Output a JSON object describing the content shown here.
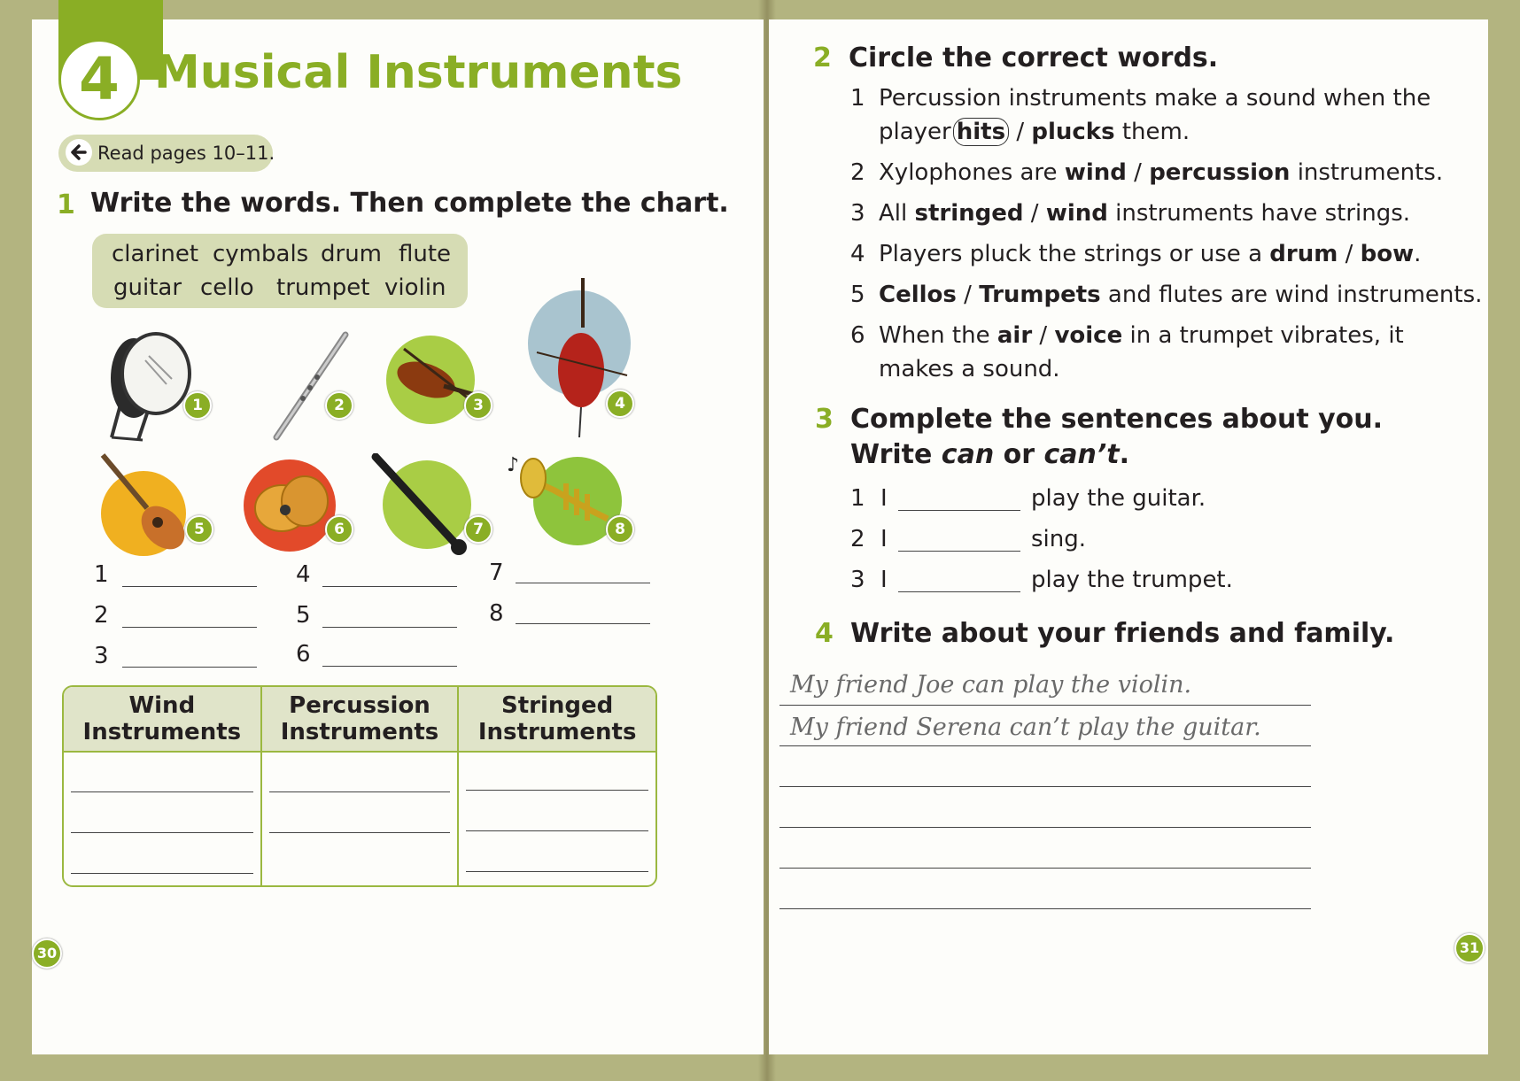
{
  "left_page": {
    "unit_number": "4",
    "title": "Musical Instruments",
    "read_pages": "Read pages 10–11.",
    "q1": {
      "number": "1",
      "instruction": "Write the words. Then complete the chart.",
      "word_bank": [
        "clarinet",
        "cymbals",
        "drum",
        "flute",
        "guitar",
        "cello",
        "trumpet",
        "violin"
      ],
      "picture_numbers": [
        "1",
        "2",
        "3",
        "4",
        "5",
        "6",
        "7",
        "8"
      ],
      "answer_labels": [
        "1",
        "2",
        "3",
        "4",
        "5",
        "6",
        "7",
        "8"
      ],
      "chart_headers": [
        "Wind Instruments",
        "Percussion Instruments",
        "Stringed Instruments"
      ]
    },
    "page_number": "30"
  },
  "right_page": {
    "q2": {
      "number": "2",
      "instruction": "Circle the correct words.",
      "items": [
        {
          "n": "1",
          "l1_pre": "Percussion instruments make a sound when the",
          "l2_pre": "player",
          "circled": "hits",
          "sep": "/",
          "bold": "plucks",
          "post": "them."
        },
        {
          "n": "2",
          "pre": "Xylophones are",
          "opt1": "wind",
          "sep": "/",
          "opt2": "percussion",
          "post": "instruments."
        },
        {
          "n": "3",
          "pre": "All",
          "opt1": "stringed",
          "sep": "/",
          "opt2": "wind",
          "post": "instruments have strings."
        },
        {
          "n": "4",
          "pre": "Players pluck the strings or use a",
          "opt1": "drum",
          "sep": "/",
          "opt2": "bow",
          "post": "."
        },
        {
          "n": "5",
          "pre": "",
          "opt1": "Cellos",
          "sep": "/",
          "opt2": "Trumpets",
          "post": "and flutes are wind instruments."
        },
        {
          "n": "6",
          "pre": "When the",
          "opt1": "air",
          "sep": "/",
          "opt2": "voice",
          "post": "in a trumpet vibrates, it",
          "line2": "makes a sound."
        }
      ]
    },
    "q3": {
      "number": "3",
      "instruction_line1": "Complete the sentences about you.",
      "instruction_line2_pre": "Write",
      "word_can": "can",
      "word_or": "or",
      "word_cant": "can’t",
      "period": ".",
      "items": [
        {
          "n": "1",
          "subject": "I",
          "text": "play the guitar."
        },
        {
          "n": "2",
          "subject": "I",
          "text": "sing."
        },
        {
          "n": "3",
          "subject": "I",
          "text": "play the trumpet."
        }
      ]
    },
    "q4": {
      "number": "4",
      "instruction": "Write about your friends and family.",
      "examples": [
        "My friend Joe can play the violin.",
        "My friend Serena can’t play the guitar."
      ]
    },
    "page_number": "31"
  },
  "colors": {
    "accent_green": "#8aae25",
    "word_bank_bg": "#d6dcb4",
    "page_bg": "#fdfdfa",
    "border": "#b3b480"
  }
}
